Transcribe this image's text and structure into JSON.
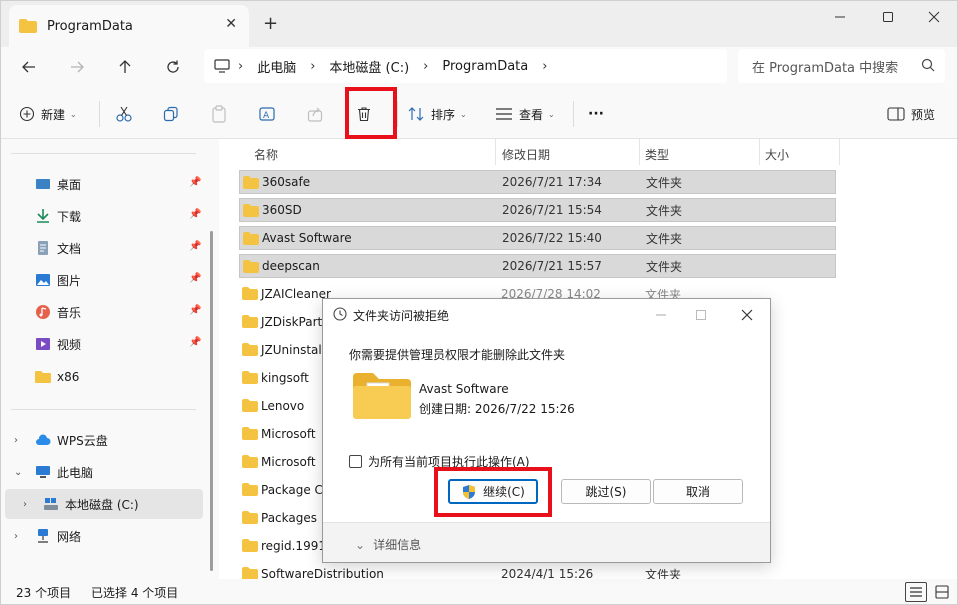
{
  "window": {
    "tab_title": "ProgramData",
    "new_tab_symbol": "+",
    "close_symbol": "✕"
  },
  "address": {
    "crumbs": [
      "此电脑",
      "本地磁盘 (C:)",
      "ProgramData"
    ],
    "search_placeholder": "在 ProgramData 中搜索"
  },
  "toolbar": {
    "new_label": "新建",
    "sort_label": "排序",
    "view_label": "查看",
    "more_label": "···",
    "preview_label": "预览"
  },
  "sidebar": {
    "items": [
      {
        "label": "桌面",
        "icon": "desktop-icon"
      },
      {
        "label": "下载",
        "icon": "download-icon"
      },
      {
        "label": "文档",
        "icon": "document-icon"
      },
      {
        "label": "图片",
        "icon": "picture-icon"
      },
      {
        "label": "音乐",
        "icon": "music-icon"
      },
      {
        "label": "视频",
        "icon": "video-icon"
      },
      {
        "label": "x86",
        "icon": "folder-icon"
      }
    ],
    "tree": [
      {
        "label": "WPS云盘",
        "icon": "cloud-icon"
      },
      {
        "label": "此电脑",
        "icon": "computer-icon"
      },
      {
        "label": "本地磁盘 (C:)",
        "icon": "drive-icon"
      },
      {
        "label": "网络",
        "icon": "network-icon"
      }
    ]
  },
  "filelist": {
    "columns": [
      "名称",
      "修改日期",
      "类型",
      "大小"
    ],
    "rows": [
      {
        "name": "360safe",
        "date": "2026/7/21 17:34",
        "type": "文件夹",
        "selected": true
      },
      {
        "name": "360SD",
        "date": "2026/7/21 15:54",
        "type": "文件夹",
        "selected": true
      },
      {
        "name": "Avast Software",
        "date": "2026/7/22 15:40",
        "type": "文件夹",
        "selected": true
      },
      {
        "name": "deepscan",
        "date": "2026/7/21 15:57",
        "type": "文件夹",
        "selected": true
      },
      {
        "name": "JZAICleaner",
        "date": "2026/7/28 14:02",
        "type": "文件夹",
        "selected": false
      },
      {
        "name": "JZDiskPart",
        "date": "",
        "type": "",
        "selected": false
      },
      {
        "name": "JZUninstall",
        "date": "",
        "type": "",
        "selected": false
      },
      {
        "name": "kingsoft",
        "date": "",
        "type": "",
        "selected": false
      },
      {
        "name": "Lenovo",
        "date": "",
        "type": "",
        "selected": false
      },
      {
        "name": "Microsoft",
        "date": "",
        "type": "",
        "selected": false
      },
      {
        "name": "Microsoft",
        "date": "",
        "type": "",
        "selected": false
      },
      {
        "name": "Package C",
        "date": "",
        "type": "",
        "selected": false
      },
      {
        "name": "Packages",
        "date": "",
        "type": "",
        "selected": false
      },
      {
        "name": "regid.1991",
        "date": "",
        "type": "",
        "selected": false
      },
      {
        "name": "SoftwareDistribution",
        "date": "2024/4/1 15:26",
        "type": "文件夹",
        "selected": false
      }
    ]
  },
  "status": {
    "count": "23 个项目",
    "selected": "已选择 4 个项目"
  },
  "dialog": {
    "title": "文件夹访问被拒绝",
    "message": "你需要提供管理员权限才能删除此文件夹",
    "folder_name": "Avast Software",
    "folder_date": "创建日期: 2026/7/22 15:26",
    "checkbox_label": "为所有当前项目执行此操作(A)",
    "continue_label": "继续(C)",
    "skip_label": "跳过(S)",
    "cancel_label": "取消",
    "details_label": "详细信息"
  },
  "colors": {
    "highlight": "#e8101a",
    "folder": "#f5c342",
    "accent": "#0067c0"
  }
}
